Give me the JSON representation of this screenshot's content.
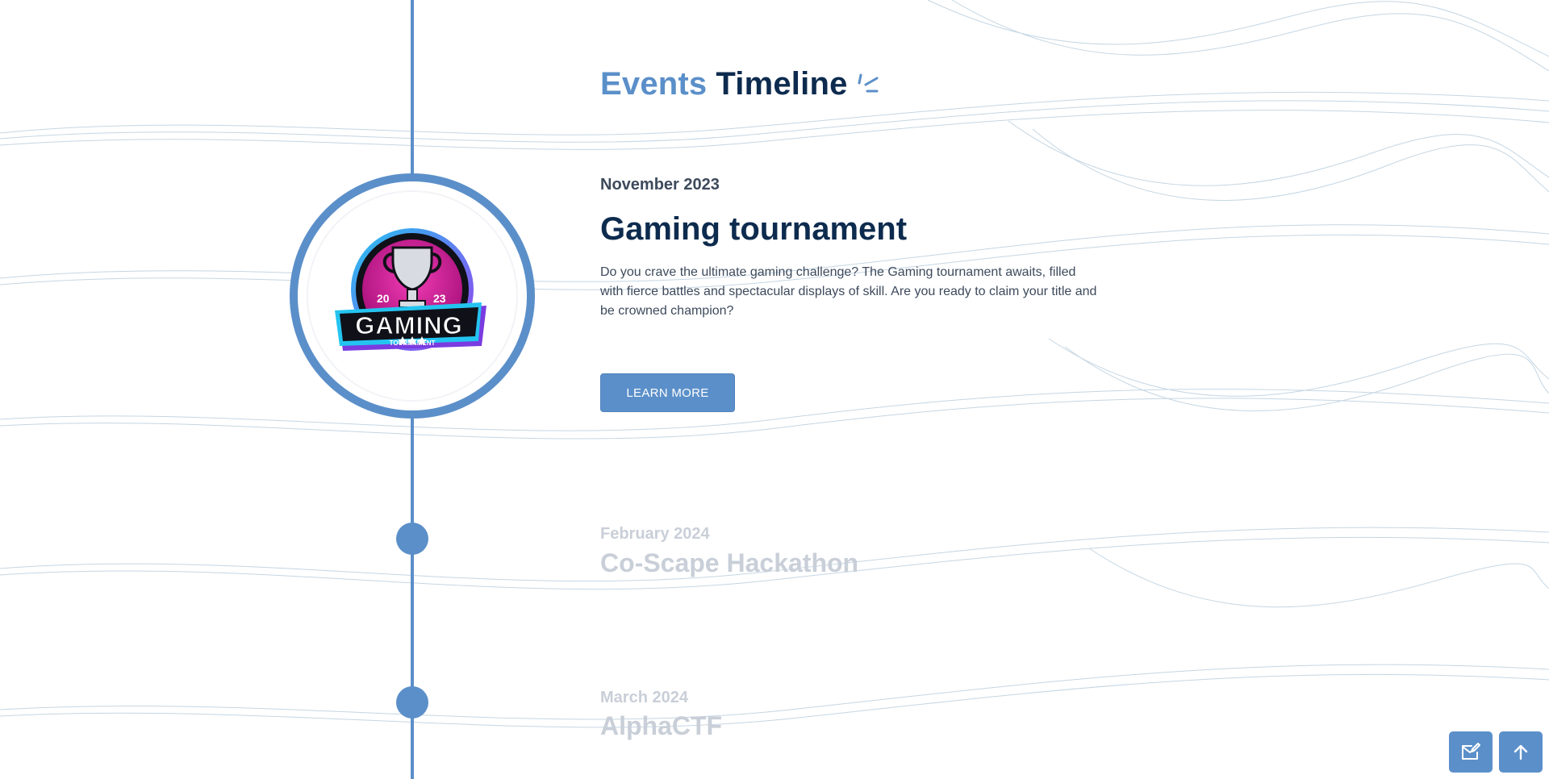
{
  "page": {
    "heading_accent": "Events",
    "heading_rest": "Timeline"
  },
  "events": [
    {
      "date": "November 2023",
      "title": "Gaming tournament",
      "description": "Do you crave the ultimate gaming challenge? The Gaming tournament awaits, filled with fierce battles and spectacular displays of skill. Are you ready to claim your title and be crowned champion?",
      "button_label": "LEARN MORE",
      "logo": {
        "year_left": "20",
        "year_right": "23",
        "word": "GAMING",
        "sub": "TOURNAMENT",
        "icon": "trophy-icon"
      }
    },
    {
      "date": "February 2024",
      "title": "Co-Scape Hackathon"
    },
    {
      "date": "March 2024",
      "title": "AlphaCTF"
    }
  ],
  "floating_buttons": {
    "mail_icon": "mail-edit-icon",
    "top_icon": "arrow-up-icon"
  },
  "colors": {
    "accent": "#5b8fc9",
    "navy": "#0d2b4e",
    "faded": "#c9cfd8"
  }
}
